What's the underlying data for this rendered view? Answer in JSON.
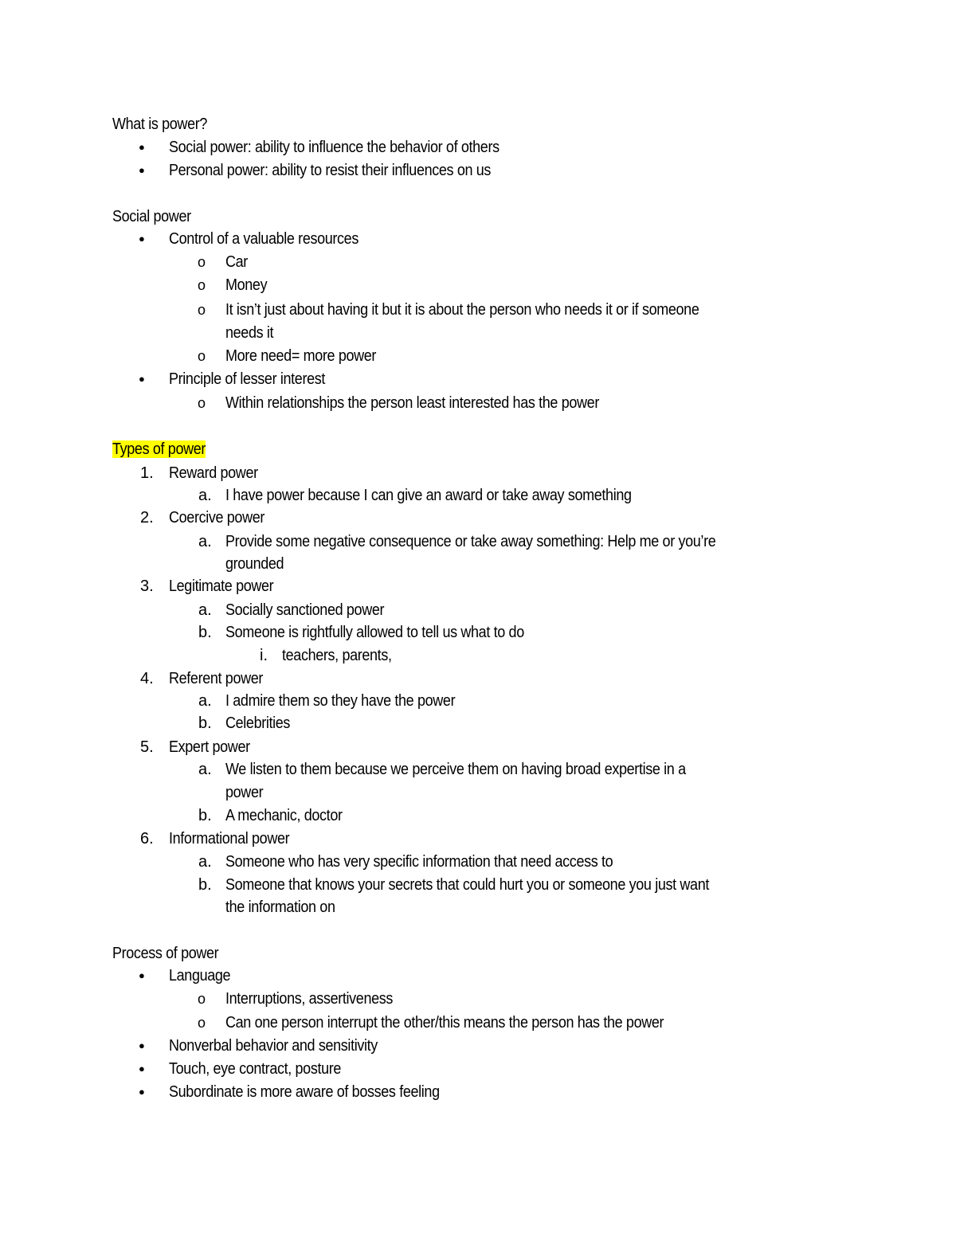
{
  "sections": {
    "what_is_power": {
      "heading": "What is power?",
      "bullets": [
        "Social power: ability to influence the behavior of others",
        "Personal power: ability to resist their influences on us"
      ]
    },
    "social_power": {
      "heading": "Social power",
      "items": [
        {
          "text": "Control of a valuable resources",
          "subitems": [
            "Car",
            "Money",
            "It isn’t just about having it but it is about the person who needs it or if someone",
            "needs it",
            "More need= more power"
          ]
        },
        {
          "text": "Principle of lesser interest",
          "subitems": [
            "Within relationships the person least interested has the power"
          ]
        }
      ]
    },
    "types_of_power": {
      "heading": "Types of power",
      "highlight_color": "#ffff00",
      "items": [
        {
          "marker": "1.",
          "text": "Reward power",
          "subitems": [
            {
              "marker": "a.",
              "text": "I have power because I can give an award or take away something"
            }
          ]
        },
        {
          "marker": "2.",
          "text": "Coercive power",
          "subitems": [
            {
              "marker": "a.",
              "text": "Provide some negative consequence or take away something: Help me or you’re",
              "cont": "grounded"
            }
          ]
        },
        {
          "marker": "3.",
          "text": "Legitimate power",
          "subitems": [
            {
              "marker": "a.",
              "text": "Socially sanctioned power"
            },
            {
              "marker": "b.",
              "text": "Someone is rightfully allowed to tell us what to do",
              "subitems": [
                {
                  "marker": "i.",
                  "text": "teachers, parents,"
                }
              ]
            }
          ]
        },
        {
          "marker": "4.",
          "text": "Referent power",
          "subitems": [
            {
              "marker": "a.",
              "text": "I admire them so they have the power"
            },
            {
              "marker": "b.",
              "text": "Celebrities"
            }
          ]
        },
        {
          "marker": "5.",
          "text": "Expert power",
          "subitems": [
            {
              "marker": "a.",
              "text": "We listen to them because we perceive them on having broad expertise in a",
              "cont": "power"
            },
            {
              "marker": "b.",
              "text": "A mechanic, doctor"
            }
          ]
        },
        {
          "marker": "6.",
          "text": "Informational power",
          "subitems": [
            {
              "marker": "a.",
              "text": "Someone who has very specific information that need access to"
            },
            {
              "marker": "b.",
              "text": "Someone that knows your secrets that could hurt you or someone you just want",
              "cont": "the information on"
            }
          ]
        }
      ]
    },
    "process_of_power": {
      "heading": "Process of power",
      "items": [
        {
          "text": "Language",
          "subitems": [
            "Interruptions, assertiveness",
            "Can one person interrupt the other/this means the person has the power"
          ]
        },
        {
          "text": "Nonverbal behavior and sensitivity"
        },
        {
          "text": "Touch, eye contract, posture"
        },
        {
          "text": "Subordinate is more aware of bosses feeling"
        }
      ]
    }
  },
  "markers": {
    "bullet": "●",
    "circle": "o"
  }
}
